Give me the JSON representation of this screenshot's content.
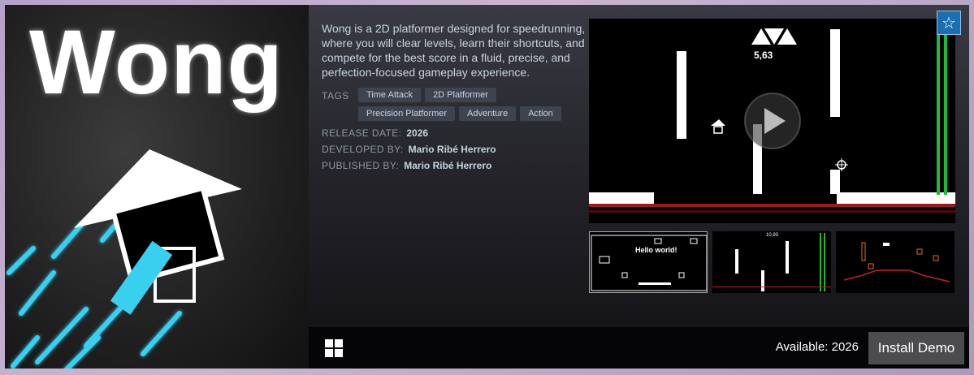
{
  "capsule": {
    "logo_text": "Wong"
  },
  "info": {
    "description": "Wong is a 2D platformer designed for speedrunning, where you will clear levels, learn their shortcuts, and compete for the best score in a fluid, precise, and perfection-focused gameplay experience.",
    "tags_label": "TAGS",
    "tags": [
      "Time Attack",
      "2D Platformer",
      "Precision Platformer",
      "Adventure",
      "Action"
    ],
    "release_label": "RELEASE DATE:",
    "release_value": "2026",
    "developer_label": "DEVELOPED BY:",
    "developer_value": "Mario Ribé Herrero",
    "publisher_label": "PUBLISHED BY:",
    "publisher_value": "Mario Ribé Herrero"
  },
  "video": {
    "timer": "5,63",
    "play_icon": "play-icon"
  },
  "thumbnails": [
    {
      "name": "screenshot-1",
      "text": "Hello world!"
    },
    {
      "name": "screenshot-2",
      "text": "10,93"
    },
    {
      "name": "screenshot-3",
      "text": ""
    }
  ],
  "wishlist": {
    "icon": "star-icon"
  },
  "footer": {
    "platform_icon": "windows-icon",
    "available_text": "Available: 2026",
    "install_label": "Install Demo"
  },
  "colors": {
    "accent": "#1a6fb3",
    "tag_bg": "#3d4450",
    "text": "#c6d4df",
    "cyan": "#39d0f0"
  }
}
